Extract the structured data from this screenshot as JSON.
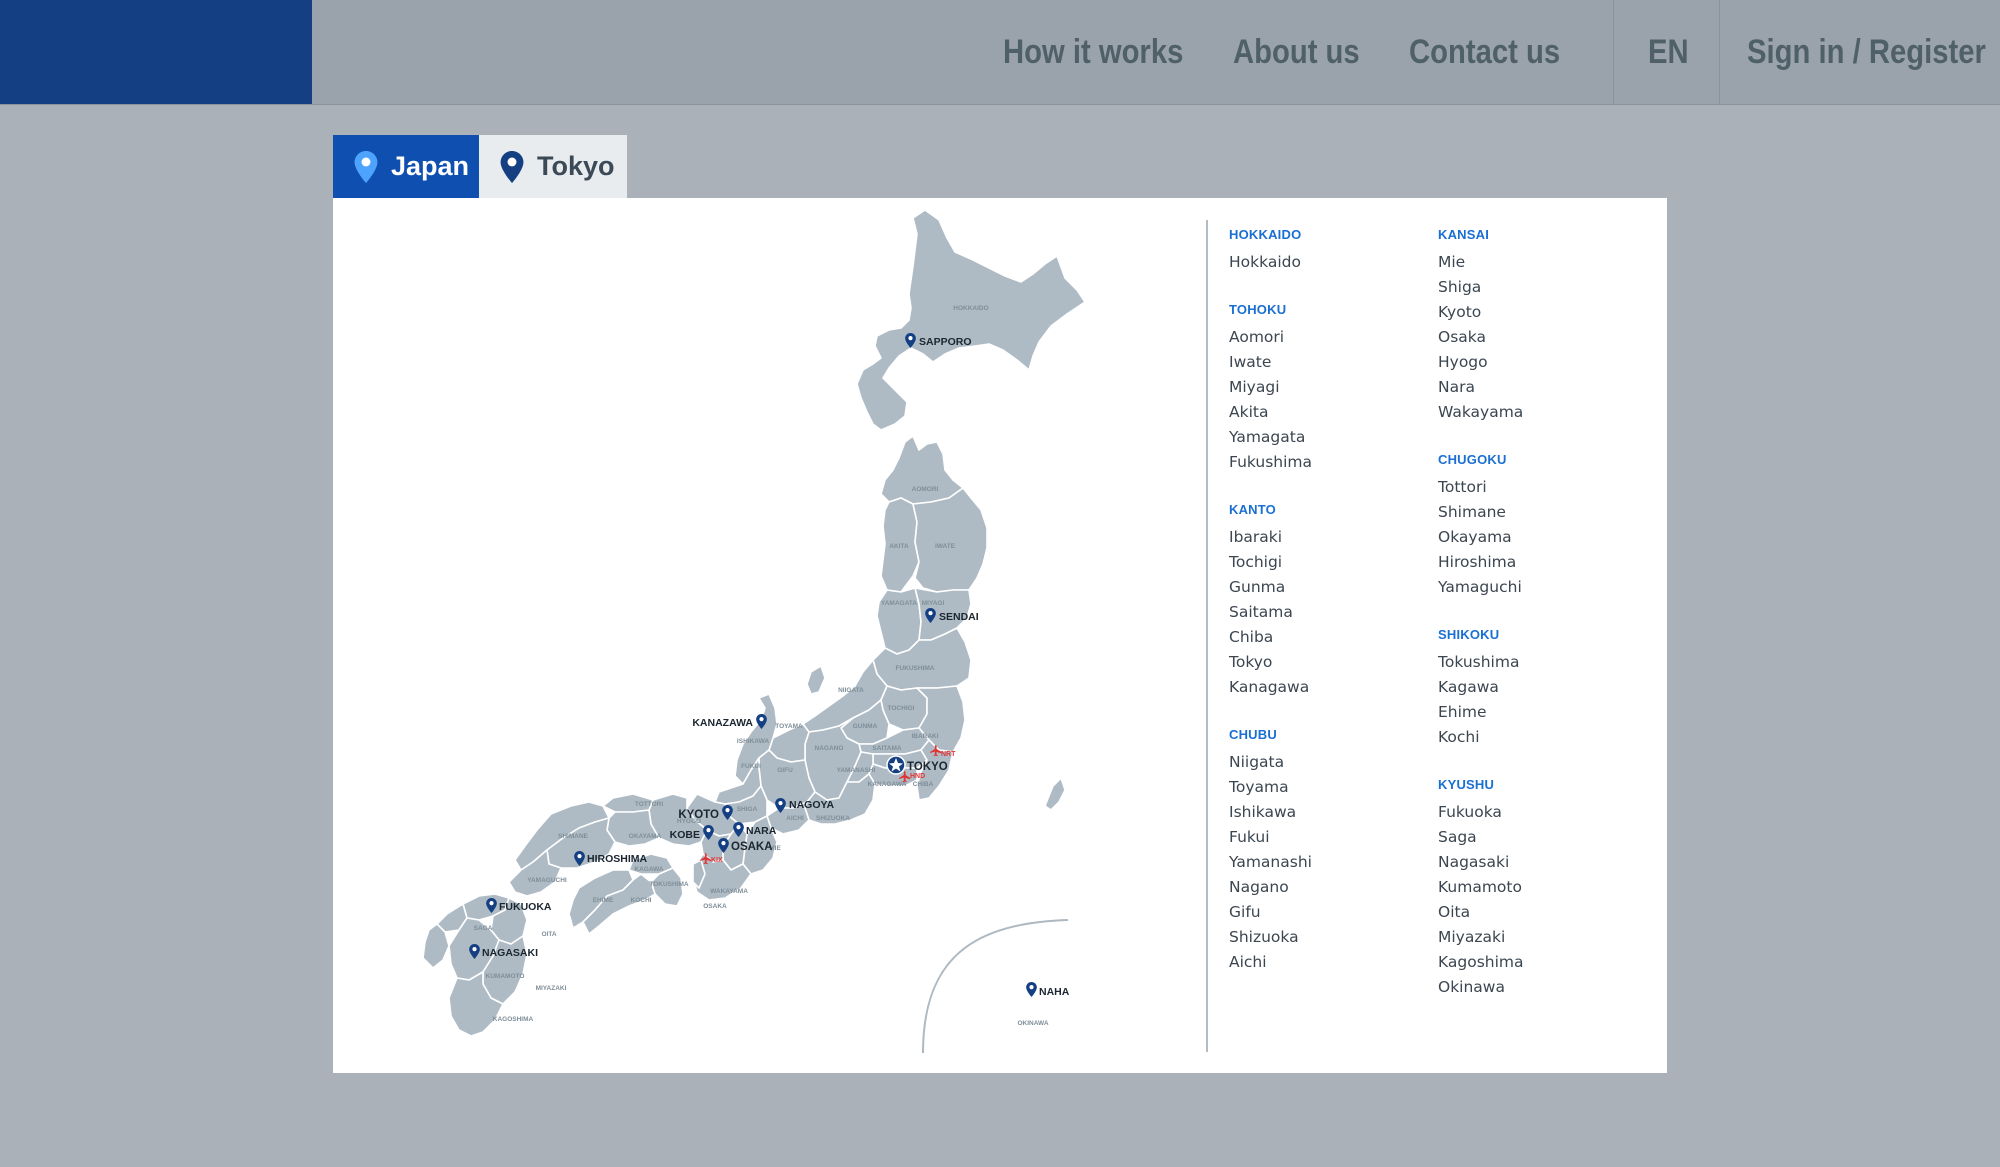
{
  "header": {
    "nav": [
      {
        "id": "how-it-works",
        "label": "How it works"
      },
      {
        "id": "about-us",
        "label": "About us"
      },
      {
        "id": "contact-us",
        "label": "Contact us"
      }
    ],
    "language": "EN",
    "sign_in": "Sign in / Register"
  },
  "tabs": [
    {
      "id": "japan",
      "label": "Japan",
      "active": true,
      "icon": "location-pin-icon"
    },
    {
      "id": "tokyo",
      "label": "Tokyo",
      "active": false,
      "icon": "location-pin-icon"
    }
  ],
  "colors": {
    "brand": "#153f83",
    "active_tab": "#0f4fb0",
    "region_heading": "#1a6fd2",
    "map_land": "#aebbc5",
    "map_pin": "#153f83",
    "airport": "#e03535"
  },
  "map": {
    "cities": [
      "SAPPORO",
      "SENDAI",
      "KANAZAWA",
      "TOKYO",
      "NAGOYA",
      "KYOTO",
      "KOBE",
      "NARA",
      "OSAKA",
      "HIROSHIMA",
      "FUKUOKA",
      "NAGASAKI",
      "NAHA"
    ],
    "prefecture_labels": [
      "HOKKAIDO",
      "AOMORI",
      "AKITA",
      "IWATE",
      "YAMAGATA",
      "MIYAGI",
      "FUKUSHIMA",
      "NIIGATA",
      "TOCHIGI",
      "TOYAMA",
      "ISHIKAWA",
      "GUNMA",
      "IBARAKI",
      "NAGANO",
      "SAITAMA",
      "FUKUI",
      "GIFU",
      "YAMANASHI",
      "KANAGAWA",
      "CHIBA",
      "TOTTORI",
      "SHIGA",
      "HYOGO",
      "AICHI",
      "SHIZUOKA",
      "SHIMANE",
      "OKAYAMA",
      "MIE",
      "YAMAGUCHI",
      "KAGAWA",
      "TOKUSHIMA",
      "WAKAYAMA",
      "EHIME",
      "KOCHI",
      "OSAKA",
      "SAGA",
      "OITA",
      "KUMAMOTO",
      "MIYAZAKI",
      "KAGOSHIMA",
      "OKINAWA"
    ],
    "airports": [
      "NRT",
      "HND",
      "KIX"
    ]
  },
  "regions_left": [
    {
      "name": "HOKKAIDO",
      "prefectures": [
        "Hokkaido"
      ]
    },
    {
      "name": "TOHOKU",
      "prefectures": [
        "Aomori",
        "Iwate",
        "Miyagi",
        "Akita",
        "Yamagata",
        "Fukushima"
      ]
    },
    {
      "name": "KANTO",
      "prefectures": [
        "Ibaraki",
        "Tochigi",
        "Gunma",
        "Saitama",
        "Chiba",
        "Tokyo",
        "Kanagawa"
      ]
    },
    {
      "name": "CHUBU",
      "prefectures": [
        "Niigata",
        "Toyama",
        "Ishikawa",
        "Fukui",
        "Yamanashi",
        "Nagano",
        "Gifu",
        "Shizuoka",
        "Aichi"
      ]
    }
  ],
  "regions_right": [
    {
      "name": "KANSAI",
      "prefectures": [
        "Mie",
        "Shiga",
        "Kyoto",
        "Osaka",
        "Hyogo",
        "Nara",
        "Wakayama"
      ]
    },
    {
      "name": "CHUGOKU",
      "prefectures": [
        "Tottori",
        "Shimane",
        "Okayama",
        "Hiroshima",
        "Yamaguchi"
      ]
    },
    {
      "name": "SHIKOKU",
      "prefectures": [
        "Tokushima",
        "Kagawa",
        "Ehime",
        "Kochi"
      ]
    },
    {
      "name": "KYUSHU",
      "prefectures": [
        "Fukuoka",
        "Saga",
        "Nagasaki",
        "Kumamoto",
        "Oita",
        "Miyazaki",
        "Kagoshima",
        "Okinawa"
      ]
    }
  ]
}
